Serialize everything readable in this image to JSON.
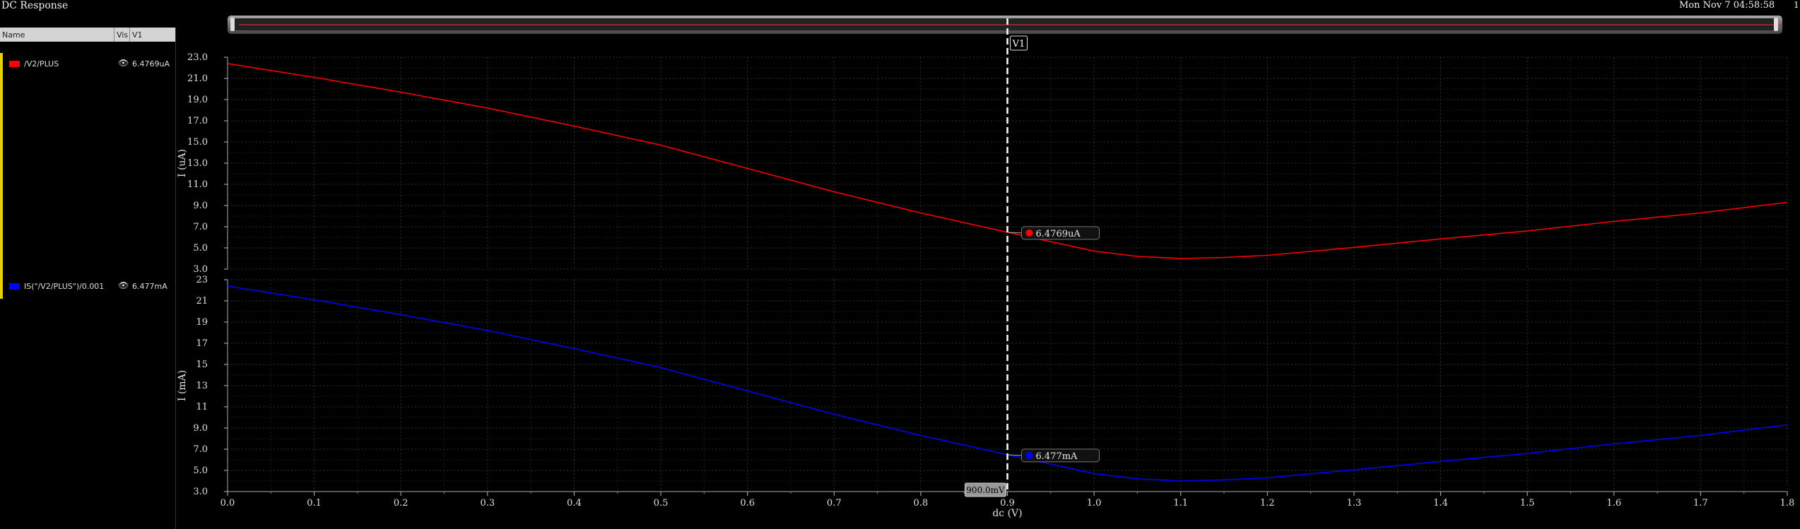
{
  "window": {
    "title": "DC Response",
    "datetime": "Mon Nov 7 04:58:58",
    "corner_label": "1"
  },
  "legend": {
    "columns": {
      "name": "Name",
      "vis": "Vis",
      "v1": "V1"
    },
    "traces": [
      {
        "name": "/V2/PLUS",
        "color": "#ff0000",
        "value": "6.4769uA"
      },
      {
        "name": "IS(\"/V2/PLUS\")/0.001",
        "color": "#0000ff",
        "value": "6.477mA"
      }
    ]
  },
  "cursor": {
    "name": "V1",
    "x_label": "900.0mV",
    "x_value": 0.9
  },
  "chart_data": [
    {
      "type": "line",
      "ylabel": "I (uA)",
      "ylim": [
        3.0,
        23.0
      ],
      "yticks": [
        "23.0",
        "21.0",
        "19.0",
        "17.0",
        "15.0",
        "13.0",
        "11.0",
        "9.0",
        "7.0",
        "5.0",
        "3.0"
      ],
      "series": [
        {
          "name": "/V2/PLUS",
          "color": "#ff0000",
          "x": [
            0.0,
            0.1,
            0.2,
            0.3,
            0.4,
            0.5,
            0.6,
            0.7,
            0.8,
            0.9,
            1.0,
            1.05,
            1.1,
            1.15,
            1.2,
            1.3,
            1.4,
            1.5,
            1.6,
            1.7,
            1.8
          ],
          "y": [
            22.4,
            21.1,
            19.7,
            18.2,
            16.5,
            14.7,
            12.5,
            10.3,
            8.3,
            6.48,
            4.7,
            4.2,
            4.0,
            4.1,
            4.3,
            5.05,
            5.85,
            6.6,
            7.5,
            8.3,
            9.3
          ]
        }
      ],
      "marker": {
        "label": "6.4769uA",
        "x": 0.9,
        "y": 6.4769
      }
    },
    {
      "type": "line",
      "ylabel": "I (mA)",
      "xlabel": "dc (V)",
      "ylim": [
        3.0,
        23.0
      ],
      "yticks": [
        "23",
        "21",
        "19",
        "17",
        "15",
        "13",
        "11",
        "9.0",
        "7.0",
        "5.0",
        "3.0"
      ],
      "xticks": [
        "0.0",
        "0.1",
        "0.2",
        "0.3",
        "0.4",
        "0.5",
        "0.6",
        "0.7",
        "0.8",
        "0.9",
        "1.0",
        "1.1",
        "1.2",
        "1.3",
        "1.4",
        "1.5",
        "1.6",
        "1.7",
        "1.8"
      ],
      "xlim": [
        0.0,
        1.8
      ],
      "series": [
        {
          "name": "IS(\"/V2/PLUS\")/0.001",
          "color": "#0000ff",
          "x": [
            0.0,
            0.1,
            0.2,
            0.3,
            0.4,
            0.5,
            0.6,
            0.7,
            0.8,
            0.9,
            1.0,
            1.05,
            1.1,
            1.15,
            1.2,
            1.3,
            1.4,
            1.5,
            1.6,
            1.7,
            1.8
          ],
          "y": [
            22.4,
            21.1,
            19.7,
            18.2,
            16.5,
            14.7,
            12.5,
            10.3,
            8.3,
            6.48,
            4.7,
            4.2,
            4.0,
            4.1,
            4.3,
            5.05,
            5.85,
            6.6,
            7.5,
            8.3,
            9.3
          ]
        }
      ],
      "marker": {
        "label": "6.477mA",
        "x": 0.9,
        "y": 6.477
      }
    }
  ]
}
